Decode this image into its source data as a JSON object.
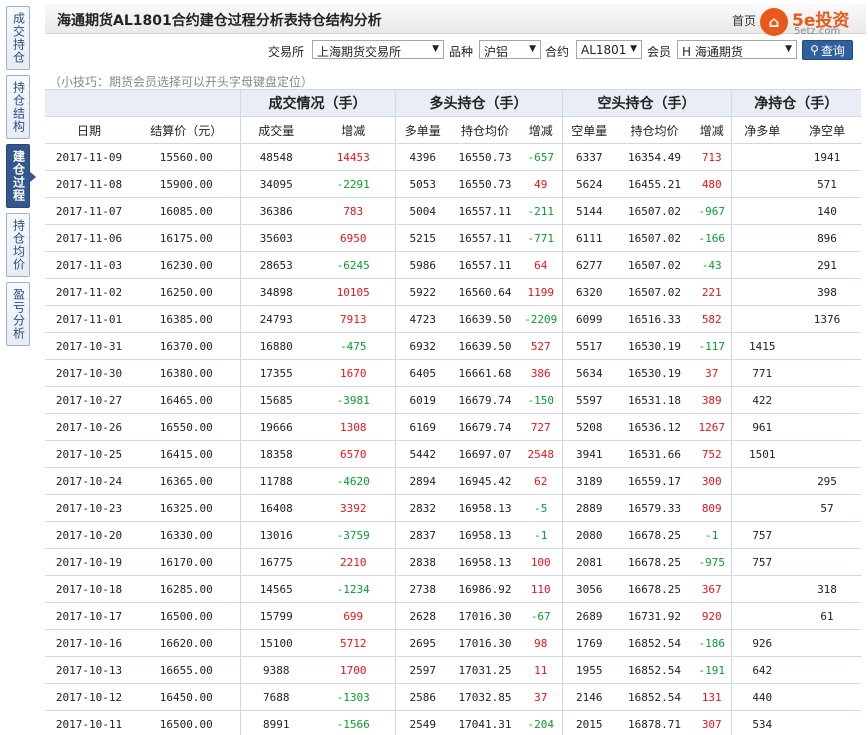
{
  "sidebar": {
    "tabs": [
      {
        "label": "成交持仓",
        "active": false
      },
      {
        "label": "持仓结构",
        "active": false
      },
      {
        "label": "建仓过程",
        "active": true
      },
      {
        "label": "持仓均价",
        "active": false
      },
      {
        "label": "盈亏分析",
        "active": false
      }
    ]
  },
  "header": {
    "title": "海通期货AL1801合约建仓过程分析表持仓结构分析",
    "logo_text": "5e投资",
    "logo_sub": "5etz.com",
    "logo_partial": "首页"
  },
  "filters": {
    "exchange_label": "交易所",
    "exchange_value": "上海期货交易所",
    "variety_label": "品种",
    "variety_value": "沪铝",
    "contract_label": "合约",
    "contract_value": "AL1801",
    "member_label": "会员",
    "member_value": "H 海通期货",
    "query_label": "查询"
  },
  "tip": "（小技巧：期货会员选择可以开头字母键盘定位）",
  "table": {
    "groups": [
      "成交情况（手）",
      "多头持仓（手）",
      "空头持仓（手）",
      "净持仓（手）"
    ],
    "columns": [
      "日期",
      "结算价（元）",
      "成交量",
      "增减",
      "多单量",
      "持仓均价",
      "增减",
      "空单量",
      "持仓均价",
      "增减",
      "净多单",
      "净空单"
    ],
    "rows": [
      [
        "2017-11-09",
        "15560.00",
        "48548",
        "14453",
        "4396",
        "16550.73",
        "-657",
        "6337",
        "16354.49",
        "713",
        "",
        "1941"
      ],
      [
        "2017-11-08",
        "15900.00",
        "34095",
        "-2291",
        "5053",
        "16550.73",
        "49",
        "5624",
        "16455.21",
        "480",
        "",
        "571"
      ],
      [
        "2017-11-07",
        "16085.00",
        "36386",
        "783",
        "5004",
        "16557.11",
        "-211",
        "5144",
        "16507.02",
        "-967",
        "",
        "140"
      ],
      [
        "2017-11-06",
        "16175.00",
        "35603",
        "6950",
        "5215",
        "16557.11",
        "-771",
        "6111",
        "16507.02",
        "-166",
        "",
        "896"
      ],
      [
        "2017-11-03",
        "16230.00",
        "28653",
        "-6245",
        "5986",
        "16557.11",
        "64",
        "6277",
        "16507.02",
        "-43",
        "",
        "291"
      ],
      [
        "2017-11-02",
        "16250.00",
        "34898",
        "10105",
        "5922",
        "16560.64",
        "1199",
        "6320",
        "16507.02",
        "221",
        "",
        "398"
      ],
      [
        "2017-11-01",
        "16385.00",
        "24793",
        "7913",
        "4723",
        "16639.50",
        "-2209",
        "6099",
        "16516.33",
        "582",
        "",
        "1376"
      ],
      [
        "2017-10-31",
        "16370.00",
        "16880",
        "-475",
        "6932",
        "16639.50",
        "527",
        "5517",
        "16530.19",
        "-117",
        "1415",
        ""
      ],
      [
        "2017-10-30",
        "16380.00",
        "17355",
        "1670",
        "6405",
        "16661.68",
        "386",
        "5634",
        "16530.19",
        "37",
        "771",
        ""
      ],
      [
        "2017-10-27",
        "16465.00",
        "15685",
        "-3981",
        "6019",
        "16679.74",
        "-150",
        "5597",
        "16531.18",
        "389",
        "422",
        ""
      ],
      [
        "2017-10-26",
        "16550.00",
        "19666",
        "1308",
        "6169",
        "16679.74",
        "727",
        "5208",
        "16536.12",
        "1267",
        "961",
        ""
      ],
      [
        "2017-10-25",
        "16415.00",
        "18358",
        "6570",
        "5442",
        "16697.07",
        "2548",
        "3941",
        "16531.66",
        "752",
        "1501",
        ""
      ],
      [
        "2017-10-24",
        "16365.00",
        "11788",
        "-4620",
        "2894",
        "16945.42",
        "62",
        "3189",
        "16559.17",
        "300",
        "",
        "295"
      ],
      [
        "2017-10-23",
        "16325.00",
        "16408",
        "3392",
        "2832",
        "16958.13",
        "-5",
        "2889",
        "16579.33",
        "809",
        "",
        "57"
      ],
      [
        "2017-10-20",
        "16330.00",
        "13016",
        "-3759",
        "2837",
        "16958.13",
        "-1",
        "2080",
        "16678.25",
        "-1",
        "757",
        ""
      ],
      [
        "2017-10-19",
        "16170.00",
        "16775",
        "2210",
        "2838",
        "16958.13",
        "100",
        "2081",
        "16678.25",
        "-975",
        "757",
        ""
      ],
      [
        "2017-10-18",
        "16285.00",
        "14565",
        "-1234",
        "2738",
        "16986.92",
        "110",
        "3056",
        "16678.25",
        "367",
        "",
        "318"
      ],
      [
        "2017-10-17",
        "16500.00",
        "15799",
        "699",
        "2628",
        "17016.30",
        "-67",
        "2689",
        "16731.92",
        "920",
        "",
        "61"
      ],
      [
        "2017-10-16",
        "16620.00",
        "15100",
        "5712",
        "2695",
        "17016.30",
        "98",
        "1769",
        "16852.54",
        "-186",
        "926",
        ""
      ],
      [
        "2017-10-13",
        "16655.00",
        "9388",
        "1700",
        "2597",
        "17031.25",
        "11",
        "1955",
        "16852.54",
        "-191",
        "642",
        ""
      ],
      [
        "2017-10-12",
        "16450.00",
        "7688",
        "-1303",
        "2586",
        "17032.85",
        "37",
        "2146",
        "16852.54",
        "131",
        "440",
        ""
      ],
      [
        "2017-10-11",
        "16500.00",
        "8991",
        "-1566",
        "2549",
        "17041.31",
        "-204",
        "2015",
        "16878.71",
        "307",
        "534",
        ""
      ]
    ]
  },
  "colors": {
    "up": "#e2161c",
    "down": "#0a9b2e",
    "accent": "#33578c"
  }
}
